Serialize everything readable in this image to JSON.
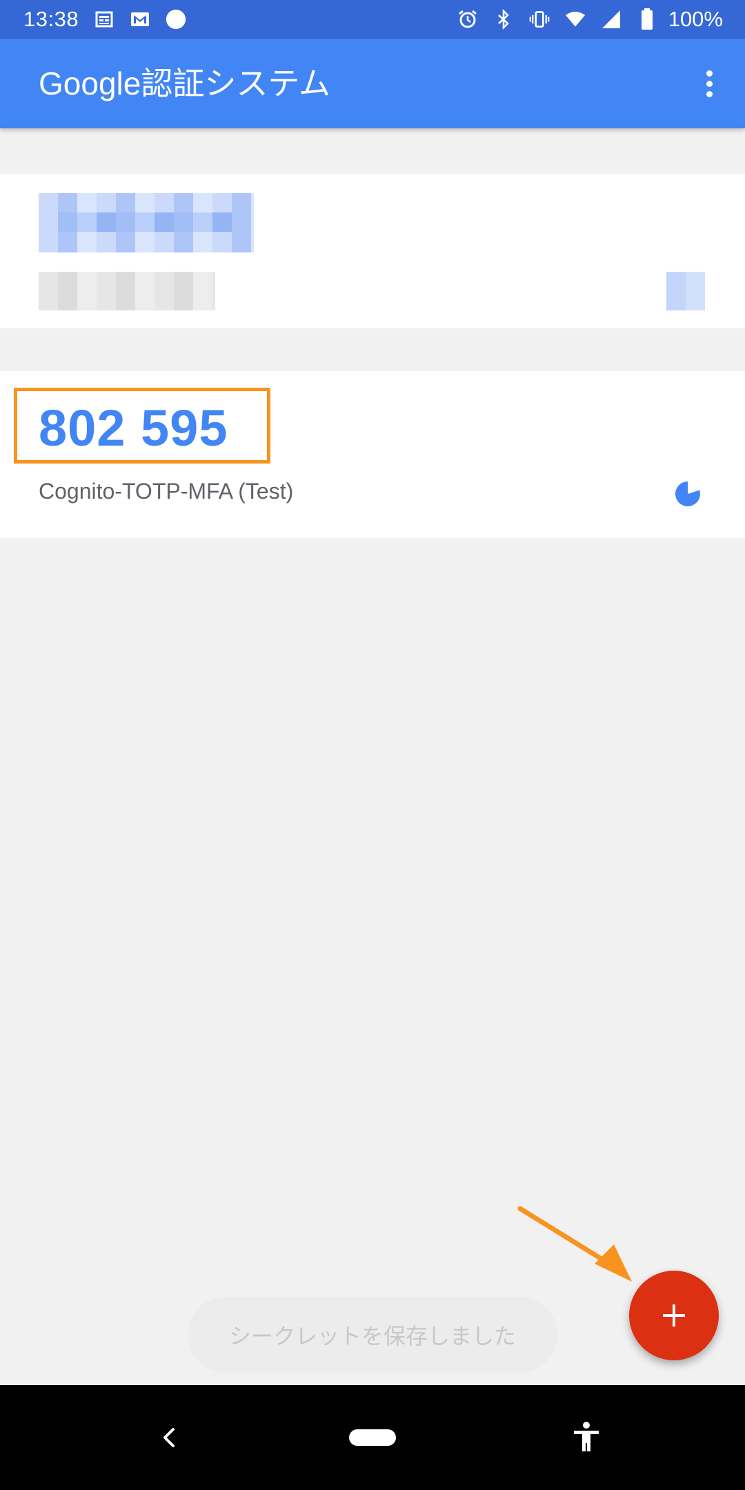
{
  "status_bar": {
    "time": "13:38",
    "battery_text": "100%",
    "icons": [
      "calendar-icon",
      "gmail-icon",
      "circle-icon",
      "alarm-icon",
      "bluetooth-icon",
      "vibrate-icon",
      "wifi-icon",
      "signal-icon",
      "battery-icon"
    ]
  },
  "app_bar": {
    "title": "Google認証システム",
    "menu_icon": "more-vert-icon"
  },
  "accounts": [
    {
      "code": "",
      "name": "",
      "obscured": true
    },
    {
      "code": "802 595",
      "name": "Cognito-TOTP-MFA (Test)",
      "timer_remaining": 0.8
    }
  ],
  "snackbar": {
    "message": "シークレットを保存しました"
  },
  "fab": {
    "icon": "plus-icon",
    "color": "#db3012"
  },
  "annotations": {
    "highlight_color": "#f7931e",
    "arrow_color": "#f7931e"
  },
  "nav_bar": {
    "icons": [
      "back-icon",
      "home-pill",
      "accessibility-icon"
    ]
  },
  "colors": {
    "primary": "#4285f4",
    "status_bar": "#3567d6"
  }
}
